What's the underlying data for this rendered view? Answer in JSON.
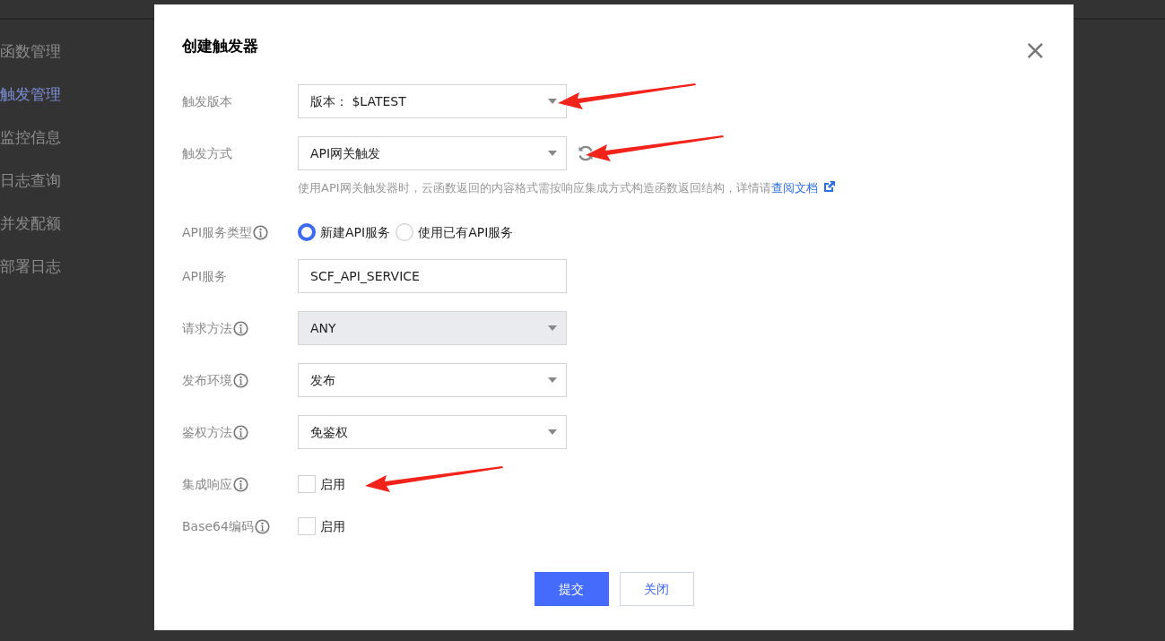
{
  "sidebar": {
    "items": [
      {
        "label": "函数管理",
        "selected": false
      },
      {
        "label": "触发管理",
        "selected": true
      },
      {
        "label": "监控信息",
        "selected": false
      },
      {
        "label": "日志查询",
        "selected": false
      },
      {
        "label": "并发配额",
        "selected": false
      },
      {
        "label": "部署日志",
        "selected": false
      }
    ]
  },
  "dialog": {
    "title": "创建触发器",
    "close": "×",
    "fields": [
      {
        "kind": "select",
        "label": "触发版本",
        "info": false,
        "value": "版本： $LATEST",
        "disabled": false,
        "refresh": false,
        "arrow": true
      },
      {
        "kind": "select",
        "label": "触发方式",
        "info": false,
        "value": "API网关触发",
        "disabled": false,
        "refresh": true,
        "arrow": true,
        "help": "使用API网关触发器时，云函数返回的内容格式需按响应集成方式构造函数返回结构，详情请",
        "help_link": "查阅文档"
      },
      {
        "kind": "radio",
        "label": "API服务类型",
        "info": true,
        "options": [
          {
            "label": "新建API服务",
            "selected": true
          },
          {
            "label": "使用已有API服务",
            "selected": false
          }
        ],
        "arrow": false
      },
      {
        "kind": "input",
        "label": "API服务",
        "info": false,
        "value": "SCF_API_SERVICE",
        "arrow": false
      },
      {
        "kind": "select",
        "label": "请求方法",
        "info": true,
        "value": "ANY",
        "disabled": true,
        "refresh": false,
        "arrow": false
      },
      {
        "kind": "select",
        "label": "发布环境",
        "info": true,
        "value": "发布",
        "disabled": false,
        "refresh": false,
        "arrow": false
      },
      {
        "kind": "select",
        "label": "鉴权方法",
        "info": true,
        "value": "免鉴权",
        "disabled": false,
        "refresh": false,
        "arrow": false
      },
      {
        "kind": "checkbox",
        "label": "集成响应",
        "info": true,
        "option": "启用",
        "checked": false,
        "arrow": true
      },
      {
        "kind": "checkbox",
        "label": "Base64编码",
        "info": true,
        "option": "启用",
        "checked": false,
        "arrow": false
      }
    ],
    "buttons": [
      {
        "label": "提交",
        "primary": true
      },
      {
        "label": "关闭",
        "primary": false
      }
    ]
  }
}
